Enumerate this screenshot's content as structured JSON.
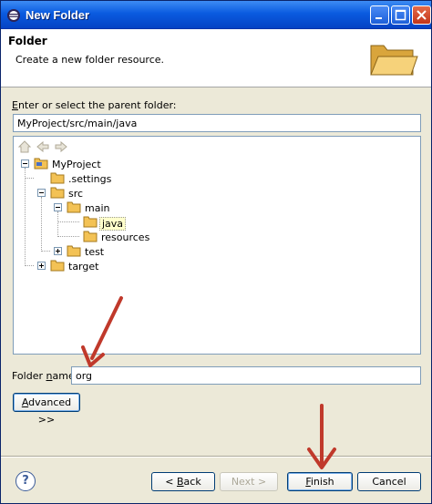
{
  "window": {
    "title": "New Folder"
  },
  "header": {
    "title": "Folder",
    "description": "Create a new folder resource."
  },
  "parent": {
    "label_prefix": "",
    "label_mnemonic": "E",
    "label_rest": "nter or select the parent folder:",
    "path_value": "MyProject/src/main/java"
  },
  "tree": {
    "toolbar_icons": [
      "home-icon",
      "back-icon",
      "forward-icon"
    ],
    "nodes": [
      {
        "label": "MyProject",
        "icon": "project-icon",
        "expander": "minus"
      },
      {
        "label": ".settings",
        "icon": "folder-icon",
        "expander": "none"
      },
      {
        "label": "src",
        "icon": "folder-icon",
        "expander": "minus"
      },
      {
        "label": "main",
        "icon": "folder-icon",
        "expander": "minus"
      },
      {
        "label": "java",
        "icon": "folder-icon",
        "expander": "none",
        "selected": true
      },
      {
        "label": "resources",
        "icon": "folder-icon",
        "expander": "none"
      },
      {
        "label": "test",
        "icon": "folder-icon",
        "expander": "plus"
      },
      {
        "label": "target",
        "icon": "folder-icon",
        "expander": "plus"
      }
    ]
  },
  "folder_name": {
    "label_prefix": "Folder ",
    "label_mnemonic": "n",
    "label_rest": "ame:",
    "value": "org"
  },
  "buttons": {
    "advanced_mnemonic": "A",
    "advanced_rest": "dvanced >>",
    "back_prefix": "< ",
    "back_mnemonic": "B",
    "back_rest": "ack",
    "next": "Next >",
    "finish_mnemonic": "F",
    "finish_rest": "inish",
    "cancel": "Cancel",
    "help": "?"
  },
  "colors": {
    "titlebar": "#0a5be0",
    "dialog_bg": "#ece9d8",
    "annotation_arrow": "#c0392b",
    "folder": "#f3c255",
    "selection_bg": "#ffffcc"
  }
}
